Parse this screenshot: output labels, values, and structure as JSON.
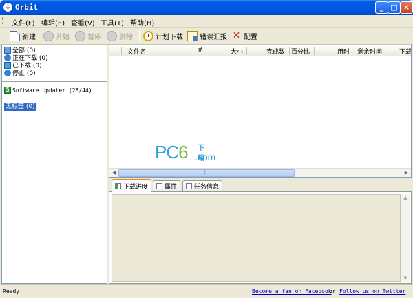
{
  "window": {
    "title": "Orbit",
    "app_icon": "down-arrow-icon"
  },
  "menu": [
    "文件(F)",
    "编辑(E)",
    "查看(V)",
    "工具(T)",
    "帮助(H)"
  ],
  "toolbar": {
    "new": "新建",
    "start": "开始",
    "pause": "暂停",
    "delete": "删除",
    "schedule": "计划下载",
    "report": "错误汇报",
    "config": "配置"
  },
  "categories": {
    "all": "全部 (0)",
    "downloading": "正在下载 (0)",
    "downloaded": "已下载 (0)",
    "stopped": "停止 (0)",
    "updater": "Software Updater (28/44)",
    "untagged": "无标签 (0)"
  },
  "list": {
    "columns": [
      "文件名",
      "#",
      "大小",
      "完成数",
      "百分比",
      "用时",
      "剩余时间",
      "下载"
    ]
  },
  "watermark": {
    "pc": "PC",
    "six": "6",
    "top": "下载",
    "bottom": ".com"
  },
  "tabs": {
    "progress": "下载进度",
    "props": "属性",
    "task": "任务信息"
  },
  "status": {
    "ready": "Ready",
    "facebook": "Become a fan on Facebook",
    "or": "or",
    "twitter": "Follow us on Twitter"
  },
  "colors": {
    "title_bar": "#0058e6",
    "selection": "#316ac5",
    "link": "#0000cc",
    "active_tab": "#e68b2c"
  }
}
